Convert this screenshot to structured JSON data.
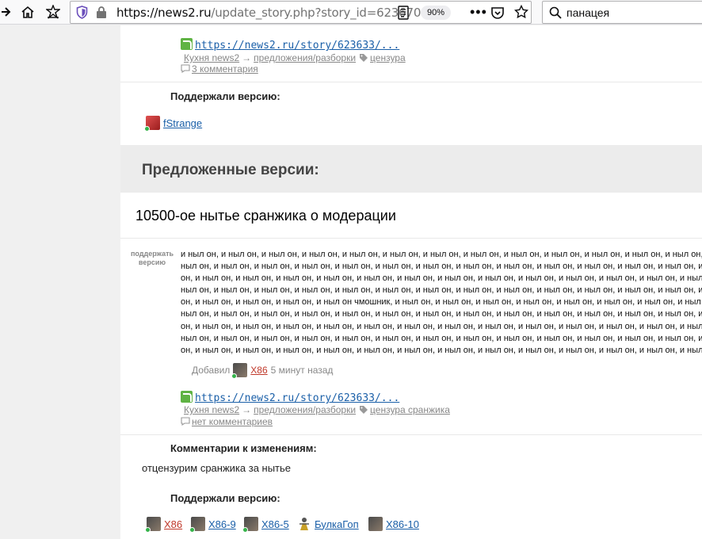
{
  "browser": {
    "url_host": "https://news2.ru",
    "url_path": "/update_story.php?story_id=623670",
    "zoom": "90%",
    "search_value": "панацея"
  },
  "top_story": {
    "link": "https://news2.ru/story/623633/...",
    "source": "Кухня news2",
    "category": "предложения/разборки",
    "tag": "цензура",
    "comments": "3 комментария"
  },
  "top_supporters": {
    "label": "Поддержали версию:",
    "users": [
      {
        "name": "fStrange",
        "avatar": "red-avatar"
      }
    ]
  },
  "proposed": {
    "section_title": "Предложенные версии:",
    "story_title": "10500-ое нытье сранжика о модерации",
    "support_button": "поддержать версию",
    "body_lines": [
      "и ныл он, и ныл он, и ныл он, и ныл он, и ныл он, и ныл он, и ныл он, и ныл он, и ныл он, и ныл он, и ныл он, и ныл он, и ныл он, и",
      "ныл он, и ныл он, и ныл он, и ныл он, и ныл он, и ныл он, и ныл он, и ныл он, и ныл он, и ныл он, и ныл он, и ныл он, и ныл он, и ныл",
      "он, и ныл он, и ныл он, и ныл он, и ныл он, и ныл он, и ныл он, и ныл он, и ныл он, и ныл он, и ныл он, и ныл он, и ныл он, и ныл он, и ныл",
      "ныл он, и ныл он, и ныл он, и ныл он, и ныл он, и ныл он, и ныл он, и ныл он, и ныл он, и ныл он, и ныл он, и ныл он, и ныл он, и ныл он",
      "он, и ныл он, и ныл он, и ныл он, и ныл он чмошник, и ныл он, и ныл он, и ныл он, и ныл он, и ныл он, и ныл он, и ныл он, и ныл он",
      "ныл он, и ныл он, и ныл он, и ныл он, и ныл он, и ныл он, и ныл он, и ныл он, и ныл он, и ныл он, и ныл он, и ныл он, и ныл он, и ныл он",
      "он, и ныл он, и ныл он, и ныл он, и ныл он, и ныл он, и ныл он, и ныл он, и ныл он, и ныл он, и ныл он, и ныл он, и ныл он, и ныл он, и ныл",
      "ныл он, и ныл он, и ныл он, и ныл он, и ныл он, и ныл он, и ныл он, и ныл он, и ныл он, и ныл он, и ныл он, и ныл он, и ныл он, и ныл он",
      "он, и ныл он, и ныл он, и ныл он, и ныл он, и ныл он, и ныл он, и ныл он, и ныл он, и ныл он, и ныл он, и ныл он, и ныл он, и ныл он, и ныл"
    ],
    "added_label": "Добавил",
    "author": "X86",
    "added_time": "5 минут назад",
    "link": "https://news2.ru/story/623633/...",
    "source": "Кухня news2",
    "category": "предложения/разборки",
    "tag": "цензура сранжика",
    "comments": "нет комментариев",
    "changes_label": "Комментарии к изменениям:",
    "changes_text": "отцензурим сранжика за нытье",
    "supporters_label": "Поддержали версию:",
    "supporters": [
      {
        "name": "X86",
        "color": "red"
      },
      {
        "name": "X86-9",
        "color": "blue"
      },
      {
        "name": "X86-5",
        "color": "blue"
      },
      {
        "name": "БулкаГоп",
        "color": "blue"
      },
      {
        "name": "X86-10",
        "color": "blue"
      }
    ]
  }
}
